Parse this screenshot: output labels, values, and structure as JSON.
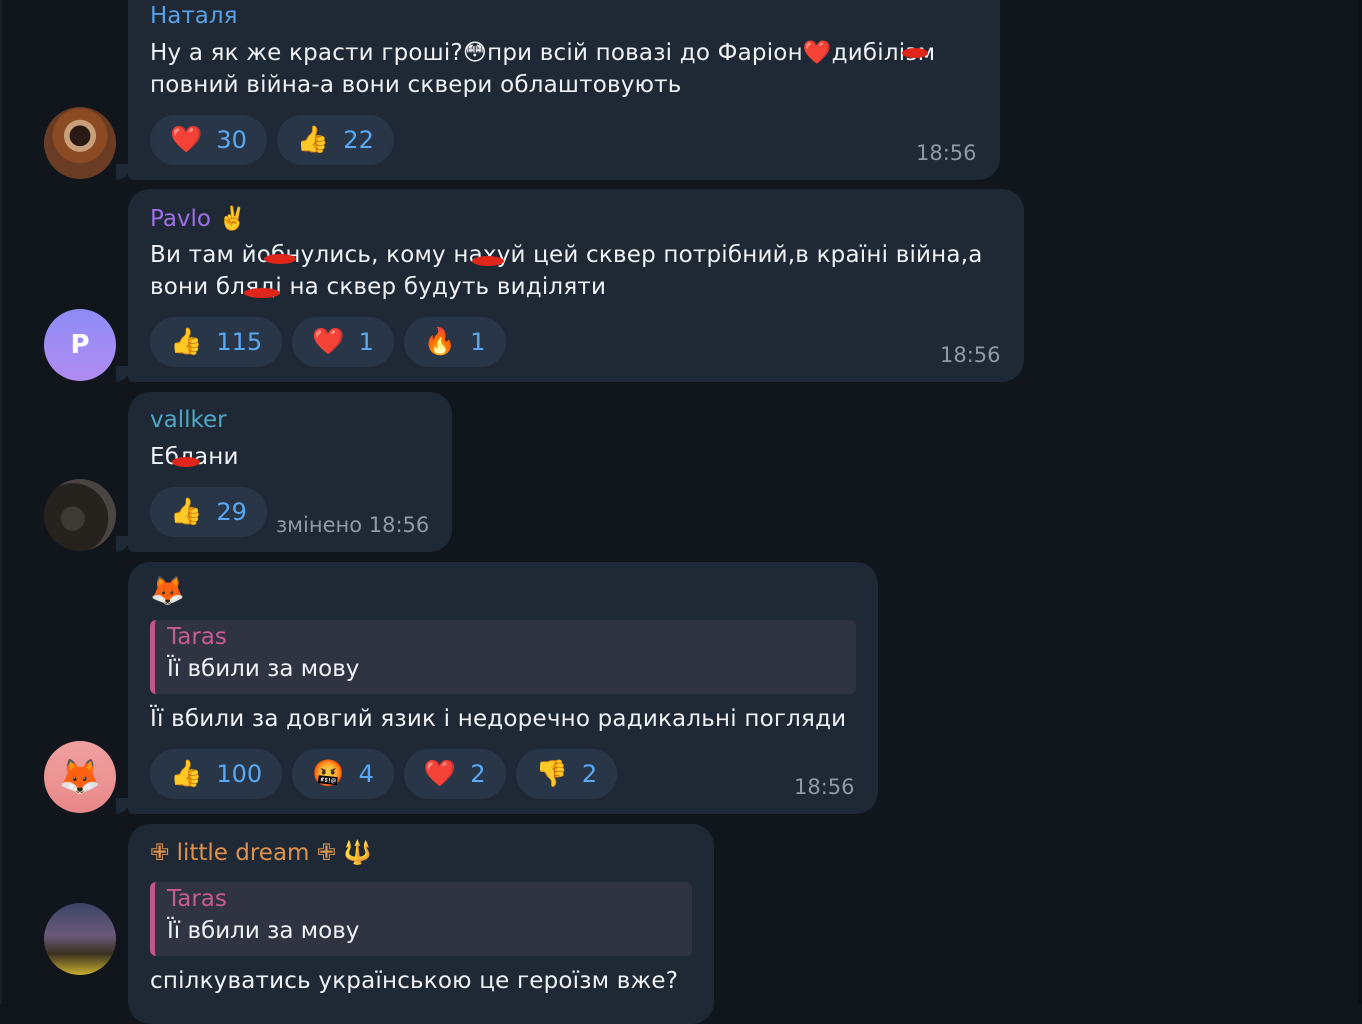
{
  "messages": [
    {
      "author": "Наталя",
      "author_color": "#5aa0e6",
      "lines": [
        "Ну а як же красти гроші?😳при всій повазі до Фаріон❤️дибілізм",
        "повний війна-а вони сквери облаштовують"
      ],
      "reactions": [
        {
          "emoji": "❤️",
          "count": "30"
        },
        {
          "emoji": "👍",
          "count": "22"
        }
      ],
      "time": "18:56"
    },
    {
      "author": "Pavlo",
      "author_badge": "✌️",
      "author_color": "#9d6fe8",
      "avatar_letter": "P",
      "lines": [
        "Ви там йобнулись, кому нахуй цей сквер потрібний,в країні війна,а",
        "вони блядi на сквер будуть виділяти"
      ],
      "reactions": [
        {
          "emoji": "👍",
          "count": "115"
        },
        {
          "emoji": "❤️",
          "count": "1"
        },
        {
          "emoji": "🔥",
          "count": "1"
        }
      ],
      "time": "18:56"
    },
    {
      "author": "vallker",
      "author_color": "#4fa6c6",
      "lines": [
        "Еблани"
      ],
      "reactions": [
        {
          "emoji": "👍",
          "count": "29"
        }
      ],
      "time": "змінено 18:56"
    },
    {
      "author": "🦊",
      "avatar_emoji": "🦊",
      "quote": {
        "author": "Taras",
        "text": "Її вбили за мову"
      },
      "lines": [
        "Її вбили за довгий язик і недоречно радикальні погляди"
      ],
      "reactions": [
        {
          "emoji": "👍",
          "count": "100"
        },
        {
          "emoji": "🤬",
          "count": "4"
        },
        {
          "emoji": "❤️",
          "count": "2"
        },
        {
          "emoji": "👎",
          "count": "2"
        }
      ],
      "time": "18:56"
    },
    {
      "author": "✙ little dream ✙",
      "author_badge": "🔱",
      "author_color": "#e0924a",
      "quote": {
        "author": "Taras",
        "text": "Її вбили за мову"
      },
      "lines": [
        "спілкуватись українською це героїзм вже?"
      ]
    }
  ],
  "colors": {
    "background": "#11151c",
    "bubble": "#1f2935",
    "reaction_bg": "#283647",
    "reaction_count": "#5aa9f4",
    "quote_bar": "#c2568c"
  }
}
